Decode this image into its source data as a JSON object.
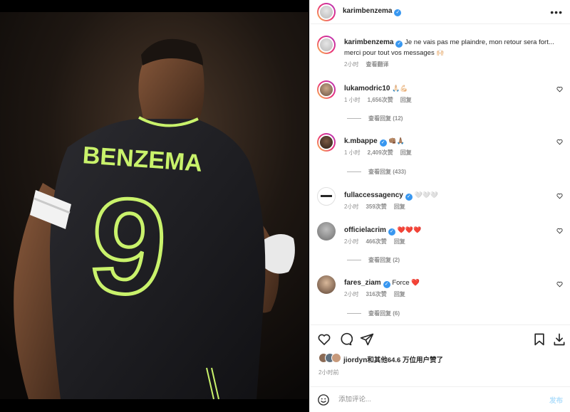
{
  "header": {
    "username": "karimbenzema",
    "more_icon": "more-horizontal-icon"
  },
  "photo": {
    "jersey_name": "BENZEMA",
    "jersey_number": "9"
  },
  "caption": {
    "username": "karimbenzema",
    "text": "Je ne vais pas me plaindre, mon retour sera fort... merci pour tout vos messages",
    "emoji": "🙌🏻",
    "time": "2小时",
    "translate": "查看翻译"
  },
  "comments": [
    {
      "username": "lukamodric10",
      "text": "🙏🏻💪🏻",
      "time": "1 小时",
      "likes": "1,656次赞",
      "reply": "回复",
      "replies": "查看回复 (12)"
    },
    {
      "username": "k.mbappe",
      "text": "👊🏽🙏🏽",
      "time": "1 小时",
      "likes": "2,409次赞",
      "reply": "回复",
      "replies": "查看回复 (433)"
    },
    {
      "username": "fullaccessagency",
      "text": "🤍🤍🤍",
      "time": "2小时",
      "likes": "359次赞",
      "reply": "回复",
      "replies": ""
    },
    {
      "username": "officielacrim",
      "text": "❤️❤️❤️",
      "time": "2小时",
      "likes": "466次赞",
      "reply": "回复",
      "replies": "查看回复 (2)"
    },
    {
      "username": "fares_ziam",
      "text": "Force ❤️",
      "time": "2小时",
      "likes": "316次赞",
      "reply": "回复",
      "replies": "查看回复 (6)"
    }
  ],
  "likes_text": {
    "user": "jiordyn",
    "rest": "和其他64.6 万位用户赞了"
  },
  "post_time": "2小时前",
  "composer": {
    "placeholder": "添加评论...",
    "post_label": "发布"
  },
  "colors": {
    "verified": "#3897f0",
    "jersey_accent": "#c9f26b",
    "heart_red": "#ed4956"
  }
}
